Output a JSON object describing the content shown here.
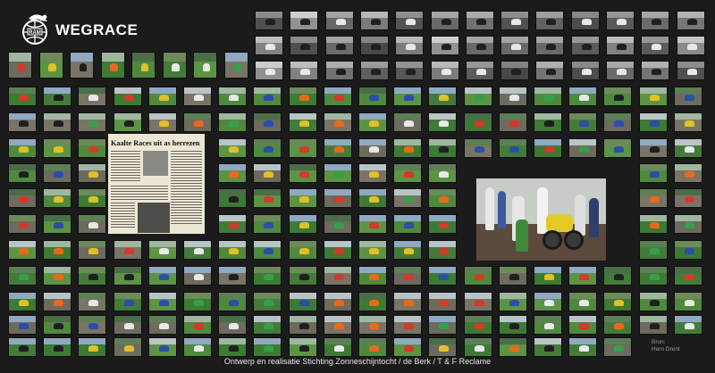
{
  "brand": {
    "title": "WEGRACE",
    "logo_text": "RAM"
  },
  "clipping": {
    "headline": "Kaalte Races uit as herrezen"
  },
  "source": {
    "label": "Bron:",
    "name": "Hero Drent"
  },
  "footer": {
    "credit": "Ontwerp en realisatie Stichting Zonneschijntocht / de Berk / T & F Reclame"
  }
}
